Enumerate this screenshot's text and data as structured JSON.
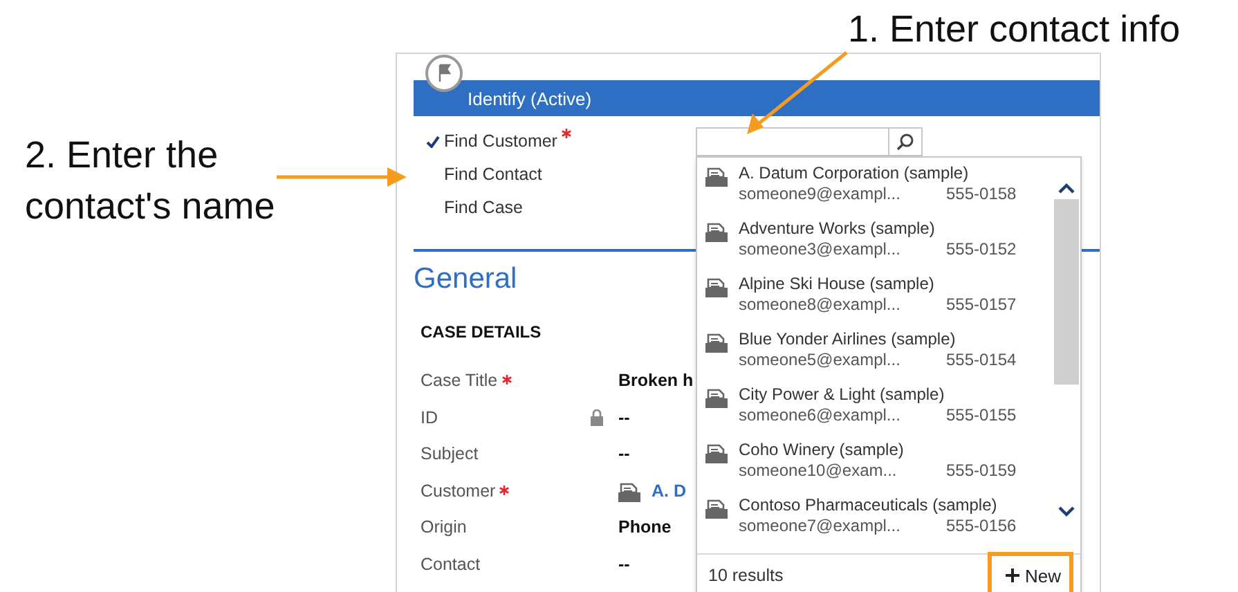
{
  "annotations": [
    {
      "text": "1. Enter contact info"
    },
    {
      "text": "2. Enter the\ncontact's name"
    }
  ],
  "stage": {
    "title": "Identify (Active)"
  },
  "steps": [
    {
      "label": "Find Customer",
      "done": true,
      "required": true
    },
    {
      "label": "Find Contact",
      "done": false,
      "required": false
    },
    {
      "label": "Find Case",
      "done": false,
      "required": false
    }
  ],
  "section": {
    "title": "General",
    "subheading": "CASE DETAILS"
  },
  "fields": [
    {
      "label": "Case Title",
      "required": true,
      "locked": false,
      "kind": "text",
      "value": "Broken h"
    },
    {
      "label": "ID",
      "required": false,
      "locked": true,
      "kind": "text",
      "value": "--"
    },
    {
      "label": "Subject",
      "required": false,
      "locked": false,
      "kind": "text",
      "value": "--"
    },
    {
      "label": "Customer",
      "required": true,
      "locked": false,
      "kind": "lookup",
      "value": "A. D"
    },
    {
      "label": "Origin",
      "required": false,
      "locked": false,
      "kind": "text",
      "value": "Phone"
    },
    {
      "label": "Contact",
      "required": false,
      "locked": false,
      "kind": "text",
      "value": "--"
    }
  ],
  "lookup": {
    "results": [
      {
        "name": "A. Datum Corporation (sample)",
        "email": "someone9@exampl...",
        "phone": "555-0158"
      },
      {
        "name": "Adventure Works (sample)",
        "email": "someone3@exampl...",
        "phone": "555-0152"
      },
      {
        "name": "Alpine Ski House (sample)",
        "email": "someone8@exampl...",
        "phone": "555-0157"
      },
      {
        "name": "Blue Yonder Airlines (sample)",
        "email": "someone5@exampl...",
        "phone": "555-0154"
      },
      {
        "name": "City Power & Light (sample)",
        "email": "someone6@exampl...",
        "phone": "555-0155"
      },
      {
        "name": "Coho Winery (sample)",
        "email": "someone10@exam...",
        "phone": "555-0159"
      },
      {
        "name": "Contoso Pharmaceuticals (sample)",
        "email": "someone7@exampl...",
        "phone": "555-0156"
      }
    ],
    "count": "10 results",
    "new_label": "New",
    "new_highlighted": true
  }
}
